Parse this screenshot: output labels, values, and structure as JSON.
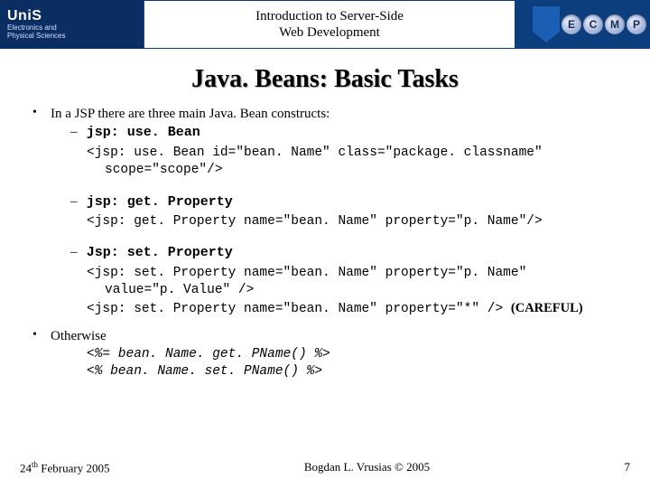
{
  "banner": {
    "logo_main": "UniS",
    "logo_sub1": "Electronics and",
    "logo_sub2": "Physical Sciences",
    "title_line1": "Introduction to Server-Side",
    "title_line2": "Web Development",
    "medals": [
      "E",
      "C",
      "M",
      "P"
    ]
  },
  "slide_title": "Java. Beans: Basic Tasks",
  "bullets": {
    "b1_text": "In a JSP there are three main Java. Bean constructs:",
    "useBean_label": "jsp: use. Bean",
    "useBean_code1": "<jsp: use. Bean id=\"bean. Name\" class=\"package. classname\"",
    "useBean_code2": "scope=\"scope\"/>",
    "getProp_label": "jsp: get. Property",
    "getProp_code": "<jsp: get. Property name=\"bean. Name\" property=\"p. Name\"/>",
    "setProp_label": "Jsp: set. Property",
    "setProp_code1": "<jsp: set. Property name=\"bean. Name\" property=\"p. Name\"",
    "setProp_code2": "value=\"p. Value\" />",
    "setProp_code3_prefix": "<jsp: set. Property name=\"bean. Name\" property=\"*\" /> ",
    "careful": "(CAREFUL)",
    "b2_text": "Otherwise",
    "scriptlet1": "<%= bean. Name. get. PName() %>",
    "scriptlet2": "<% bean. Name. set. PName() %>"
  },
  "footer": {
    "date_pre": "24",
    "date_sup": "th",
    "date_post": " February 2005",
    "center": "Bogdan L. Vrusias © 2005",
    "page": "7"
  }
}
